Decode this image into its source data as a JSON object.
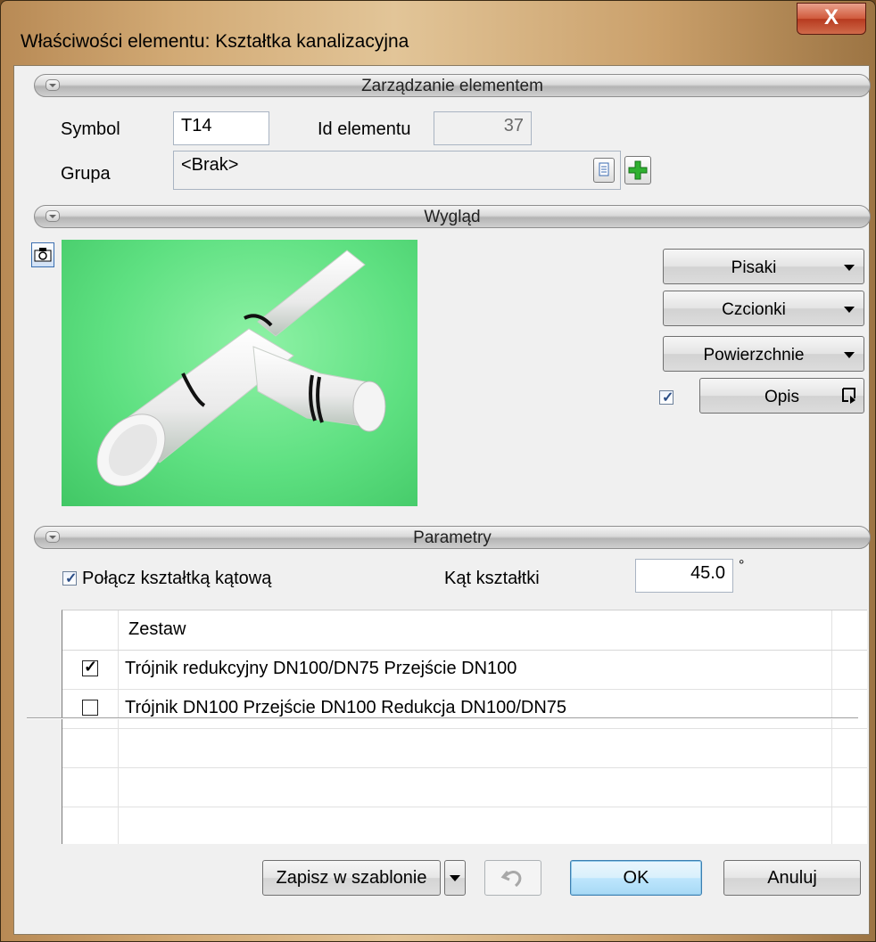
{
  "window": {
    "title": "Właściwości elementu: Kształtka kanalizacyjna",
    "close_label": "X"
  },
  "sections": {
    "management": "Zarządzanie elementem",
    "appearance": "Wygląd",
    "parameters": "Parametry"
  },
  "management": {
    "symbol_label": "Symbol",
    "symbol_value": "T14",
    "id_label": "Id elementu",
    "id_value": "37",
    "group_label": "Grupa",
    "group_value": "<Brak>"
  },
  "appearance": {
    "pens_label": "Pisaki",
    "fonts_label": "Czcionki",
    "surfaces_label": "Powierzchnie",
    "description_label": "Opis",
    "description_checked": true
  },
  "parameters": {
    "connect_label": "Połącz kształtką kątową",
    "connect_checked": true,
    "angle_label": "Kąt kształtki",
    "angle_value": "45.0",
    "angle_unit": "°"
  },
  "table": {
    "header": "Zestaw",
    "rows": [
      {
        "checked": true,
        "text": "Trójnik redukcyjny DN100/DN75  Przejście DN100"
      },
      {
        "checked": false,
        "text": "Trójnik DN100  Przejście DN100  Redukcja DN100/DN75"
      }
    ]
  },
  "footer": {
    "save_template_label": "Zapisz w szablonie",
    "ok_label": "OK",
    "cancel_label": "Anuluj"
  },
  "colors": {
    "preview_background": "#5ee081",
    "ok_accent": "#3c7fb1",
    "close_button": "#c74a2c"
  }
}
